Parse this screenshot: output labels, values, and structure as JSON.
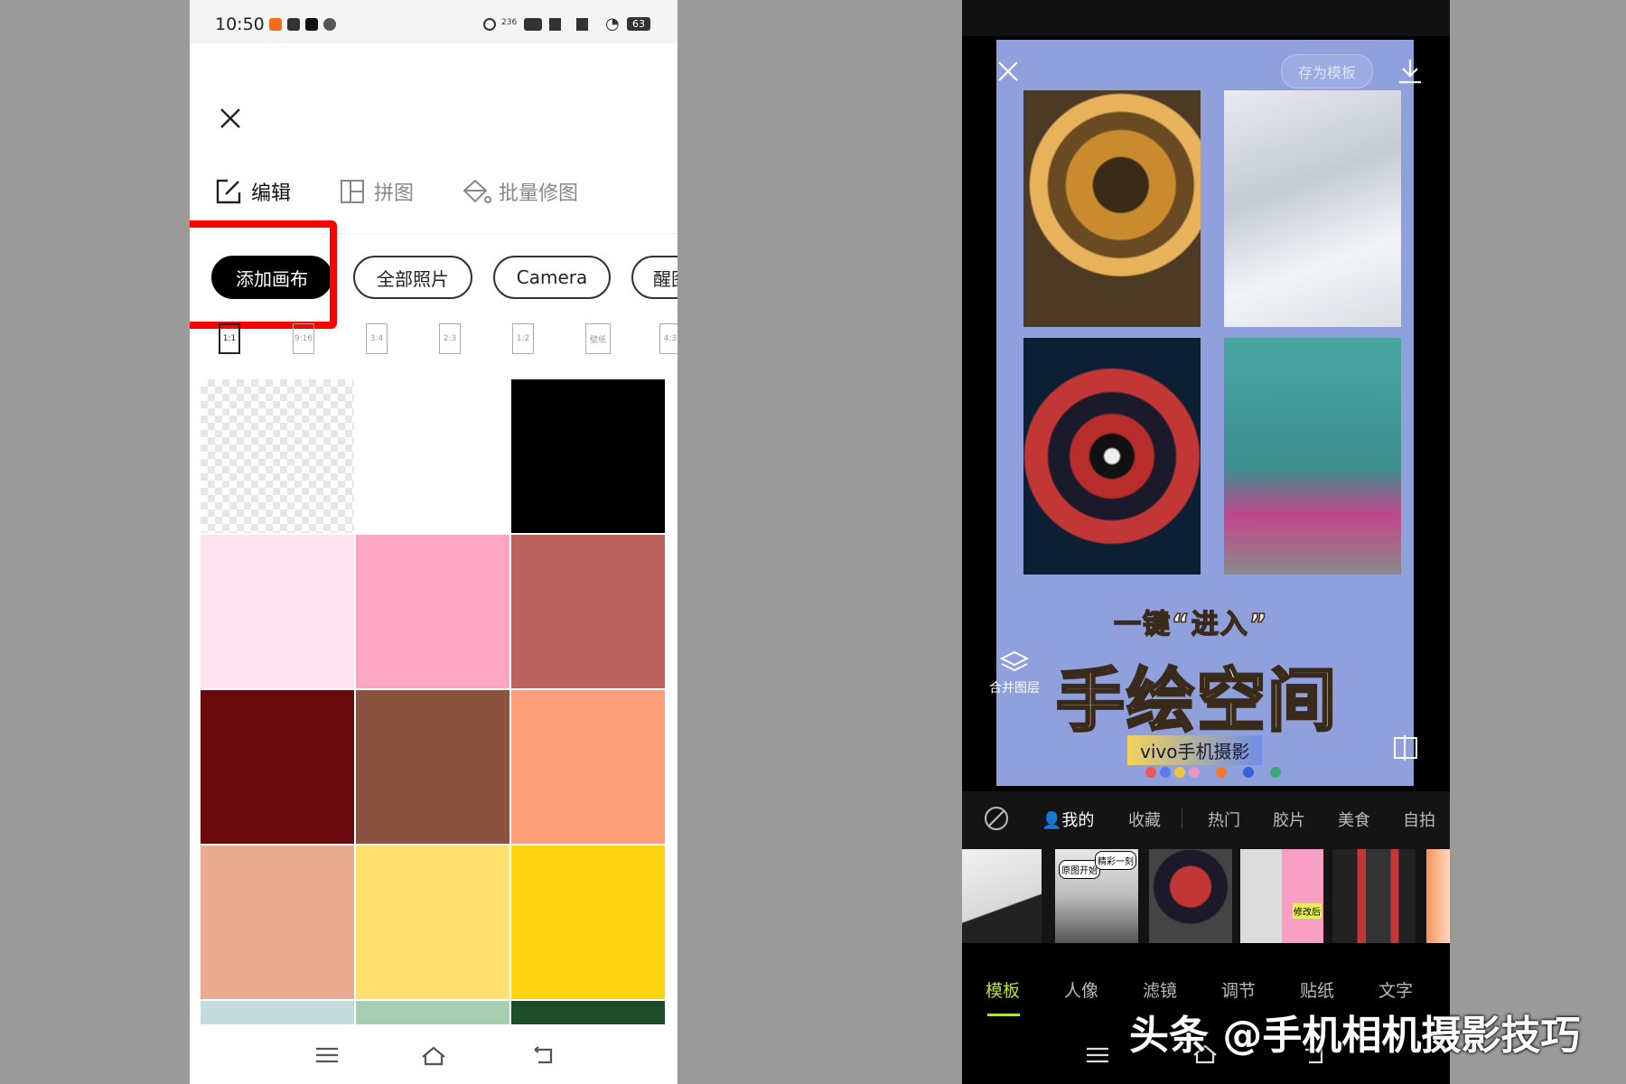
{
  "left": {
    "status": {
      "time": "10:50",
      "speed": "236",
      "battery": "63"
    },
    "toolbar": {
      "edit": "编辑",
      "collage": "拼图",
      "batch": "批量修图"
    },
    "pills": [
      "添加画布",
      "全部照片",
      "Camera",
      "醒图"
    ],
    "ratios": [
      "1:1",
      "9:16",
      "3:4",
      "2:3",
      "1:2",
      "壁纸",
      "4:3"
    ],
    "swatches": [
      "transparent",
      "#ffffff",
      "#000000",
      "#fde3ee",
      "#fda6c4",
      "#bc6360",
      "#6b0a0c",
      "#8b5240",
      "#fe9f7b",
      "#e9ab91",
      "#fee06f",
      "#fdd210",
      "#c5dcdc",
      "#a5cfb0",
      "#1e4d2a"
    ],
    "highlight_color": "#ff0000"
  },
  "right": {
    "save_template": "存为模板",
    "merge_layers": "合并图层",
    "poster": {
      "line1": "一键“进入”",
      "line2": "手绘空间",
      "line3": "vivo手机摄影"
    },
    "dot_colors": [
      "#e85a5a",
      "#5b7be8",
      "#f2c53d",
      "#e896c8",
      "#f07b2a",
      "#3860d8",
      "#3aa876"
    ],
    "categories": [
      "我的",
      "收藏",
      "热门",
      "胶片",
      "美食",
      "自拍"
    ],
    "thumb_labels": [
      "原图开始",
      "精彩一刻",
      "修改后"
    ],
    "bottom_tabs": [
      "模板",
      "人像",
      "滤镜",
      "调节",
      "贴纸",
      "文字"
    ],
    "active_tab_color": "#b6e23a"
  },
  "watermark": "头条 @手机相机摄影技巧"
}
